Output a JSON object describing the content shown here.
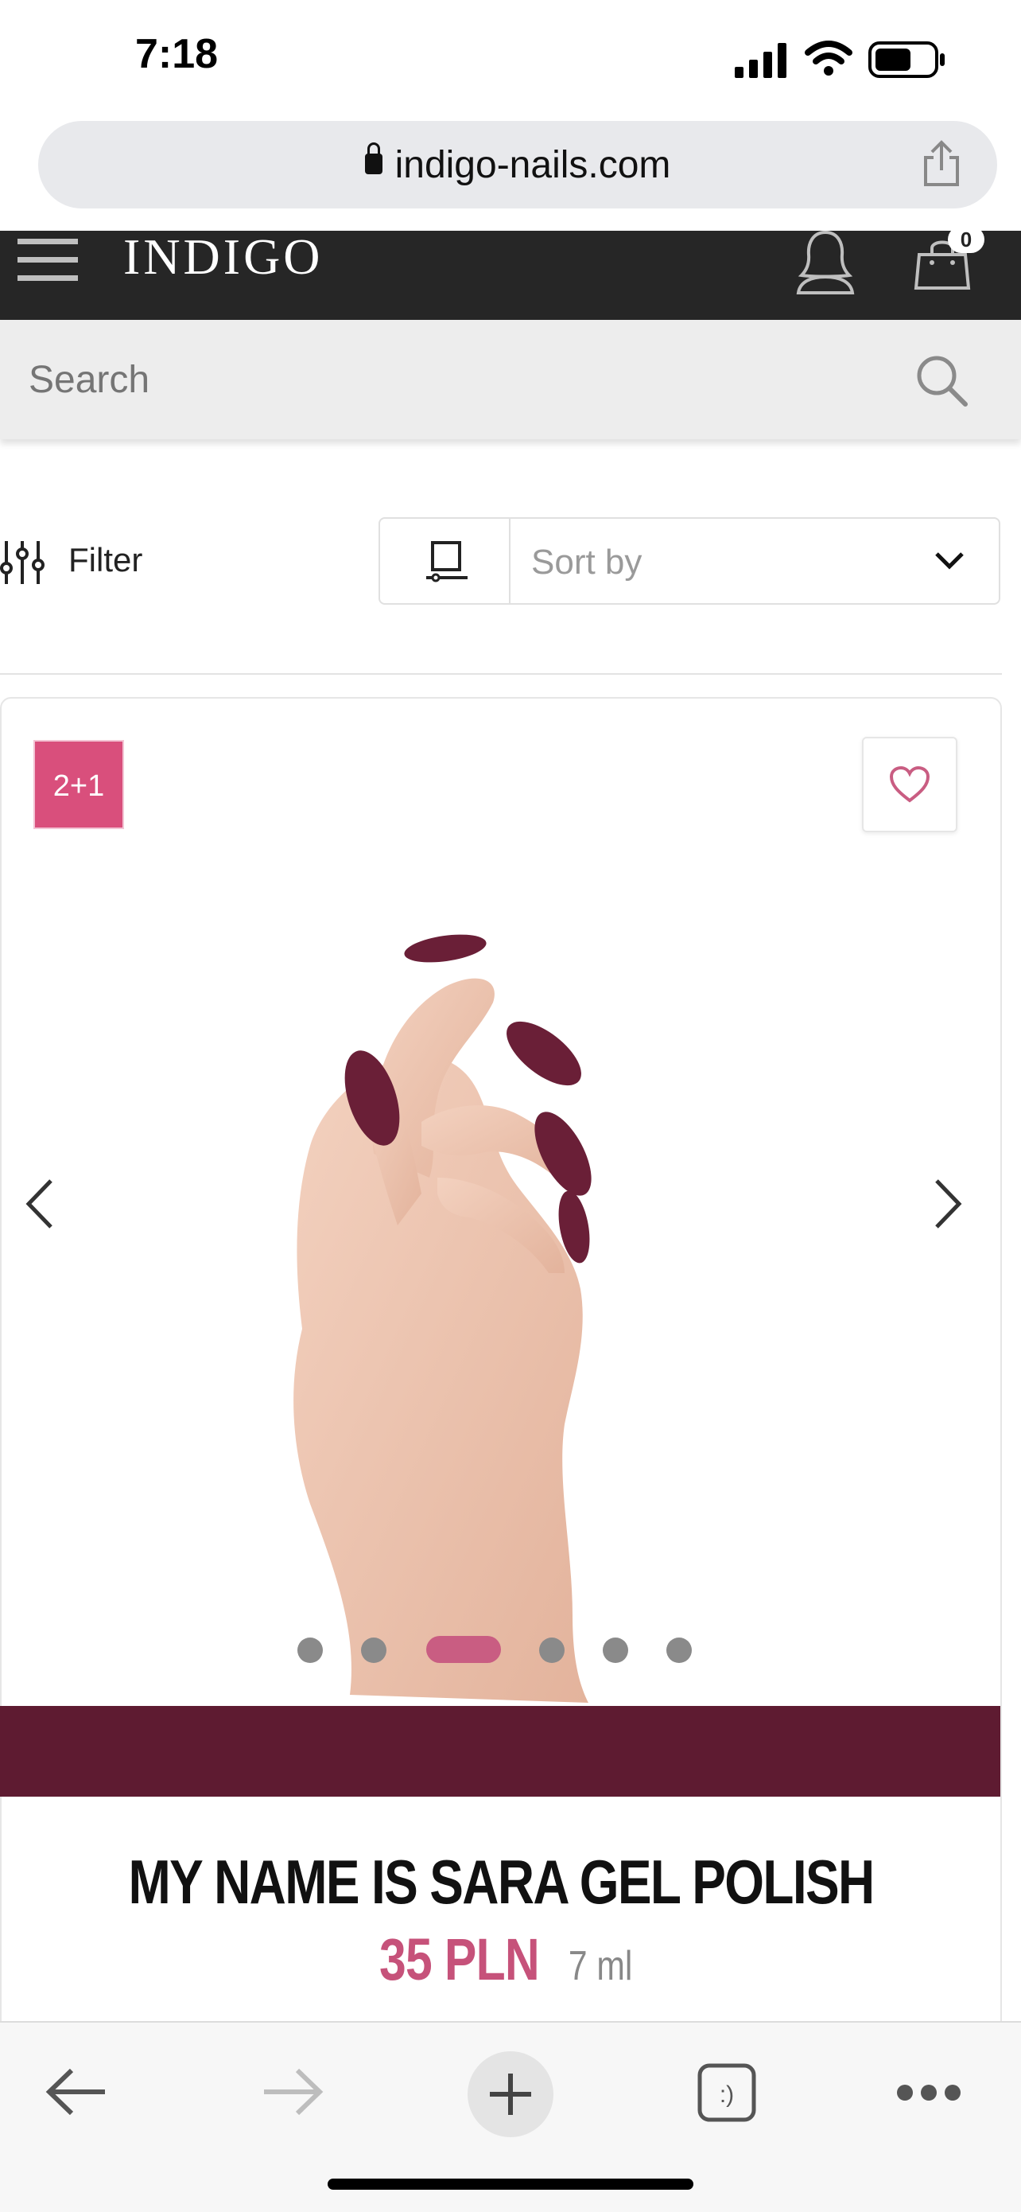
{
  "status_bar": {
    "time": "7:18"
  },
  "browser": {
    "url": "indigo-nails.com"
  },
  "header": {
    "logo": "INDIGO",
    "cart_count": "0"
  },
  "search": {
    "placeholder": "Search"
  },
  "toolbar": {
    "filter_label": "Filter",
    "sort_placeholder": "Sort by"
  },
  "product": {
    "badge": "2+1",
    "title": "MY NAME IS SARA GEL POLISH",
    "price": "35 PLN",
    "volume": "7 ml",
    "carousel_active_index": 2,
    "carousel_count": 6
  },
  "colors": {
    "accent": "#d94f7c",
    "polish": "#5e1b31",
    "price": "#c6527a",
    "header": "#262626"
  }
}
